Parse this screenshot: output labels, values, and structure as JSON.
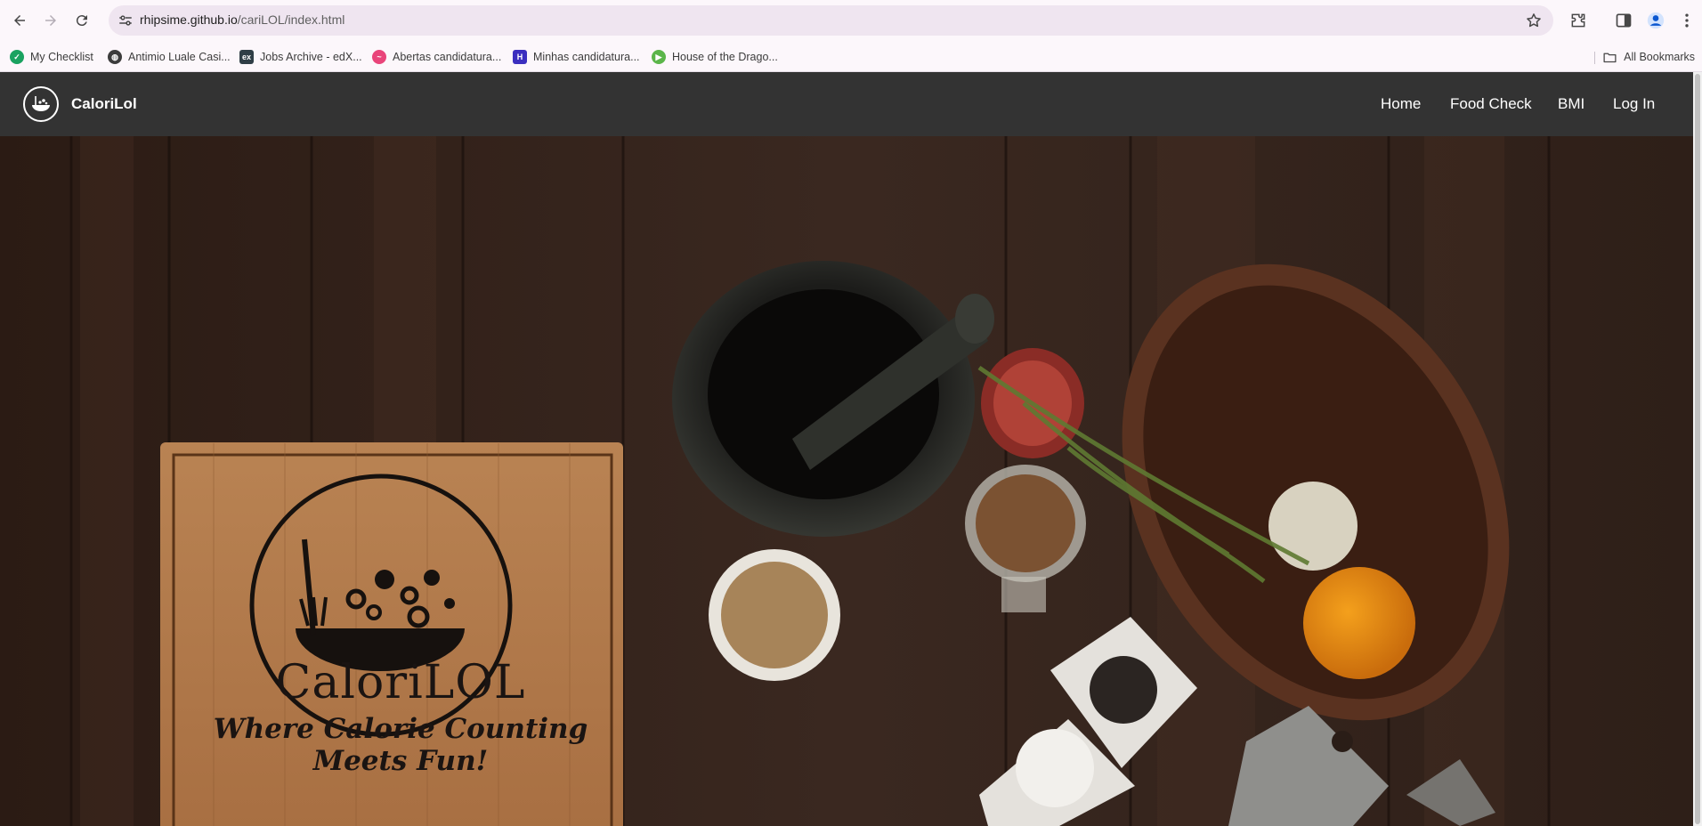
{
  "browser": {
    "url_host": "rhipsime.github.io",
    "url_path": "/cariLOL/index.html",
    "bookmarks": [
      {
        "label": "My Checklist",
        "icon": "checklist-icon",
        "color": "#1aa260"
      },
      {
        "label": "Antimio Luale Casi...",
        "icon": "globe-icon",
        "color": "#3c3c3c"
      },
      {
        "label": "Jobs Archive - edX...",
        "icon": "edx-icon",
        "color": "#2f3e46"
      },
      {
        "label": "Abertas candidatura...",
        "icon": "wave-icon",
        "color": "#e9447a"
      },
      {
        "label": "Minhas candidatura...",
        "icon": "h-icon",
        "color": "#3b2fbf"
      },
      {
        "label": "House of the Drago...",
        "icon": "play-icon",
        "color": "#5bb54a"
      }
    ],
    "all_bookmarks_label": "All Bookmarks"
  },
  "site": {
    "brand": "CaloriLol",
    "nav": [
      "Home",
      "Food Check",
      "BMI",
      "Log In"
    ],
    "hero_title": "CaloriLOL",
    "hero_tagline": "Where Calorie Counting Meets Fun!"
  }
}
